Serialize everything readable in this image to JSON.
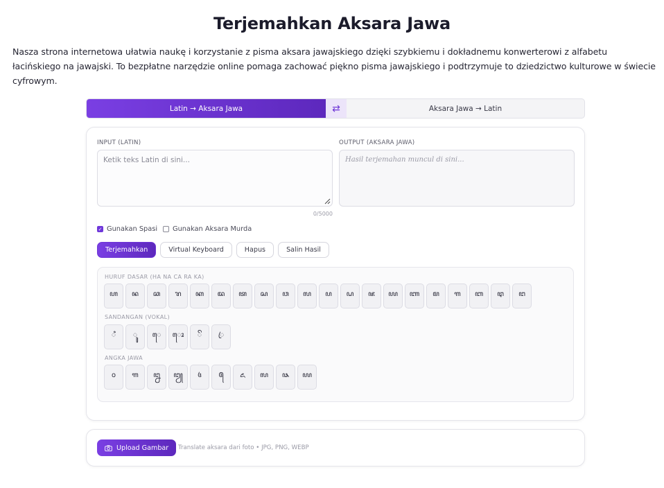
{
  "page": {
    "title": "Terjemahkan Aksara Jawa",
    "intro": "Nasza strona internetowa ułatwia naukę i korzystanie z pisma aksara jawajskiego dzięki szybkiemu i dokładnemu konwerterowi z alfabetu łacińskiego na jawajski. To bezpłatne narzędzie online pomaga zachować piękno pisma jawajskiego i podtrzymuje to dziedzictwo kulturowe w świecie cyfrowym."
  },
  "mode": {
    "active": "Latin → Aksara Jawa",
    "swap_icon": "⇄",
    "inactive": "Aksara Jawa → Latin"
  },
  "input": {
    "label": "INPUT (LATIN)",
    "placeholder": "Ketik teks Latin di sini...",
    "counter": "0/5000"
  },
  "output": {
    "label": "OUTPUT (AKSARA JAWA)",
    "placeholder": "Hasil terjemahan muncul di sini..."
  },
  "options": {
    "spasi_label": "Gunakan Spasi",
    "spasi_checked": true,
    "murda_label": "Gunakan Aksara Murda",
    "murda_checked": false
  },
  "actions": {
    "translate": "Terjemahkan",
    "keyboard": "Virtual Keyboard",
    "clear": "Hapus",
    "copy": "Salin Hasil"
  },
  "keyboard": {
    "dasar_title": "HURUF DASAR (HA NA CA RA KA)",
    "dasar": [
      "ꦲ",
      "ꦤ",
      "ꦕ",
      "ꦫ",
      "ꦏ",
      "ꦢ",
      "ꦠ",
      "ꦱ",
      "ꦮ",
      "ꦭ",
      "ꦥ",
      "ꦝ",
      "ꦗ",
      "ꦪ",
      "ꦚ",
      "ꦩ",
      "ꦒ",
      "ꦧ",
      "ꦛ",
      "ꦔ"
    ],
    "sandangan_title": "SANDANGAN (VOKAL)",
    "sandangan": [
      "ꦶ",
      "ꦸ",
      "ꦺ",
      "ꦺꦴ",
      "ꦼ",
      "ꦿ"
    ],
    "angka_title": "ANGKA JAWA",
    "angka": [
      "꧐",
      "꧑",
      "꧒",
      "꧓",
      "꧔",
      "꧕",
      "꧖",
      "꧗",
      "꧘",
      "꧙"
    ]
  },
  "upload": {
    "button": "Upload Gambar",
    "hint": "Translate aksara dari foto • JPG, PNG, WEBP"
  }
}
